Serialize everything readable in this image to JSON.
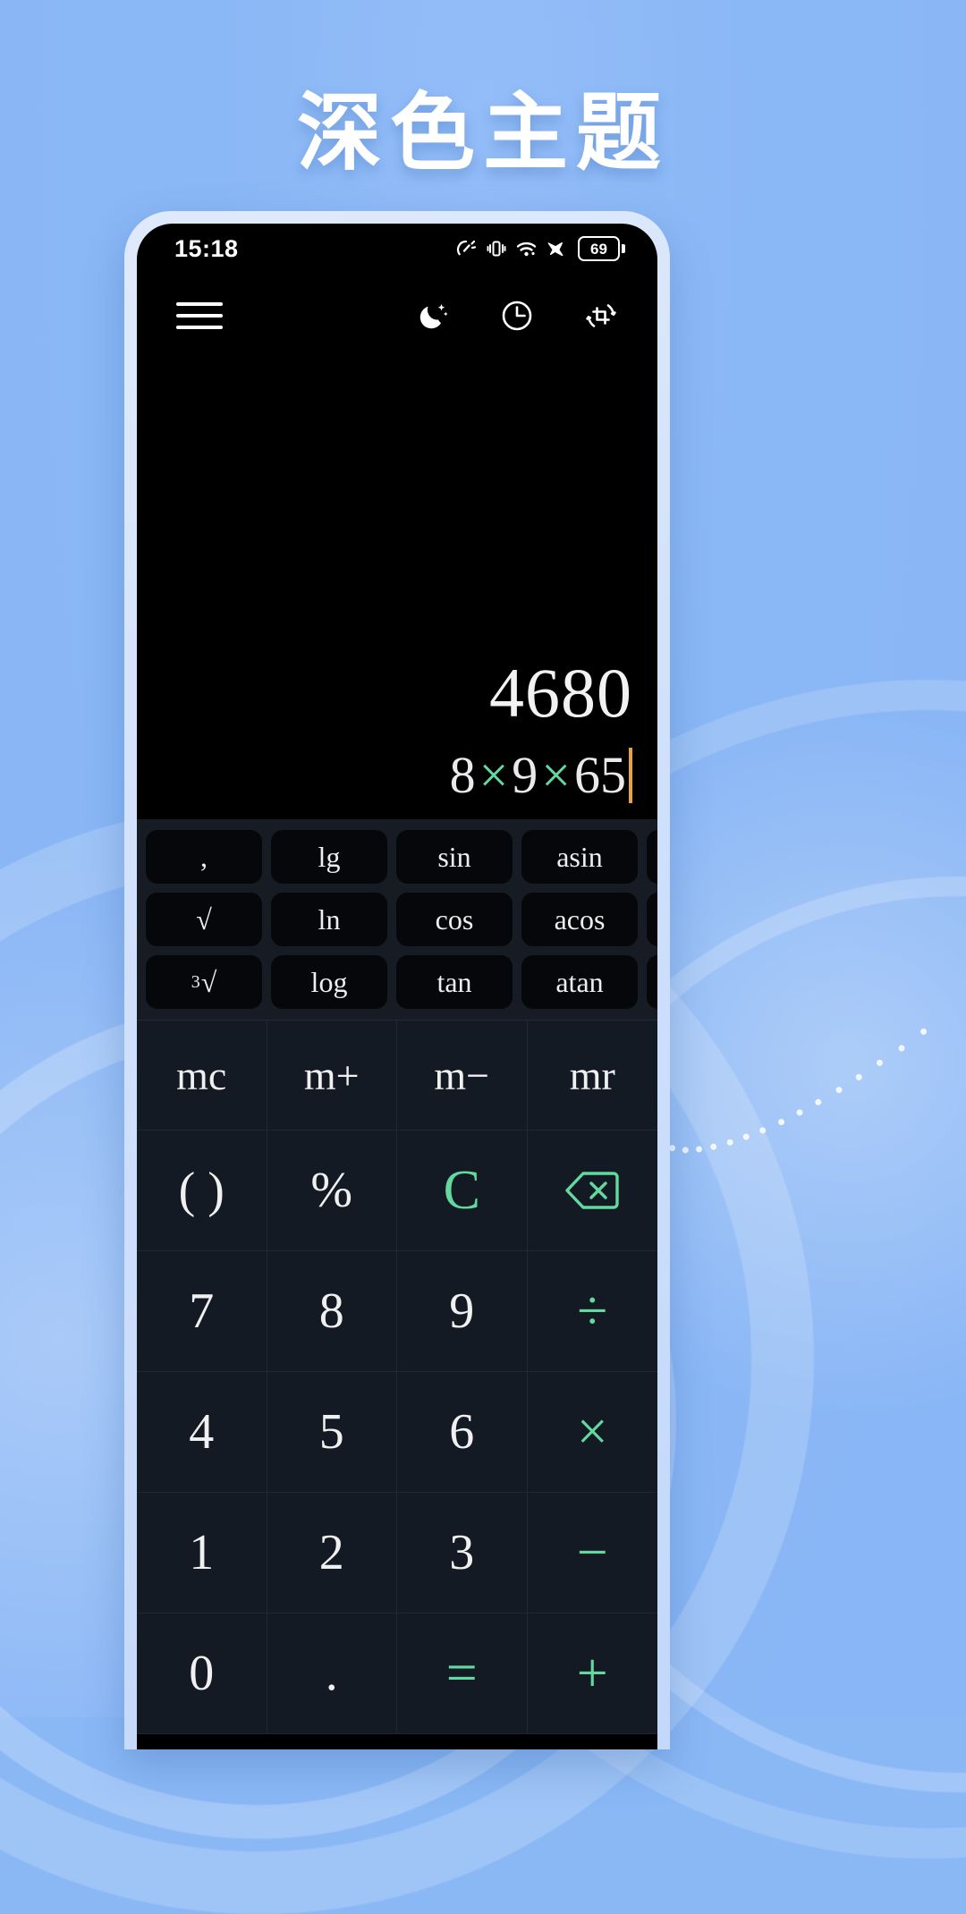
{
  "headline": "深色主题",
  "phone": {
    "statusbar": {
      "time": "15:18",
      "battery_percent": "69",
      "icons": [
        "data-speed-icon",
        "vibrate-icon",
        "wifi-icon",
        "airplane-mode-icon",
        "battery-icon"
      ]
    },
    "toolbar": {
      "menu_icon": "hamburger-menu-icon",
      "icons": [
        "night-mode-icon",
        "history-clock-icon",
        "rotate-screen-icon"
      ]
    },
    "display": {
      "result": "4680",
      "expression_parts": [
        {
          "text": "8",
          "type": "num"
        },
        {
          "text": "×",
          "type": "op"
        },
        {
          "text": "9",
          "type": "num"
        },
        {
          "text": "×",
          "type": "op"
        },
        {
          "text": "65",
          "type": "num"
        }
      ],
      "expression": "8×9×65",
      "caret_color": "#e8a33d",
      "operator_color": "#63d9a0"
    },
    "scientific_rows": [
      [
        ",",
        "lg",
        "sin",
        "asin",
        ""
      ],
      [
        "√",
        "ln",
        "cos",
        "acos",
        ""
      ],
      [
        "³√",
        "log",
        "tan",
        "atan",
        ""
      ]
    ],
    "keypad": [
      {
        "label": "mc",
        "style": "mem"
      },
      {
        "label": "m+",
        "style": "mem"
      },
      {
        "label": "m−",
        "style": "mem"
      },
      {
        "label": "mr",
        "style": "mem"
      },
      {
        "label": "( )",
        "style": "plain"
      },
      {
        "label": "%",
        "style": "plain"
      },
      {
        "label": "C",
        "style": "green"
      },
      {
        "label": "backspace",
        "style": "icon-backspace"
      },
      {
        "label": "7",
        "style": "plain"
      },
      {
        "label": "8",
        "style": "plain"
      },
      {
        "label": "9",
        "style": "plain"
      },
      {
        "label": "÷",
        "style": "green"
      },
      {
        "label": "4",
        "style": "plain"
      },
      {
        "label": "5",
        "style": "plain"
      },
      {
        "label": "6",
        "style": "plain"
      },
      {
        "label": "×",
        "style": "green"
      },
      {
        "label": "1",
        "style": "plain"
      },
      {
        "label": "2",
        "style": "plain"
      },
      {
        "label": "3",
        "style": "plain"
      },
      {
        "label": "−",
        "style": "green"
      },
      {
        "label": "0",
        "style": "plain"
      },
      {
        "label": ".",
        "style": "plain"
      },
      {
        "label": "=",
        "style": "green"
      },
      {
        "label": "+",
        "style": "green"
      }
    ]
  },
  "colors": {
    "background": "#8ab8f5",
    "accent_green": "#63d9a0",
    "caret_orange": "#e8a33d",
    "screen_black": "#000000",
    "keypad_dark": "#131a23",
    "sci_panel": "#171c24"
  }
}
